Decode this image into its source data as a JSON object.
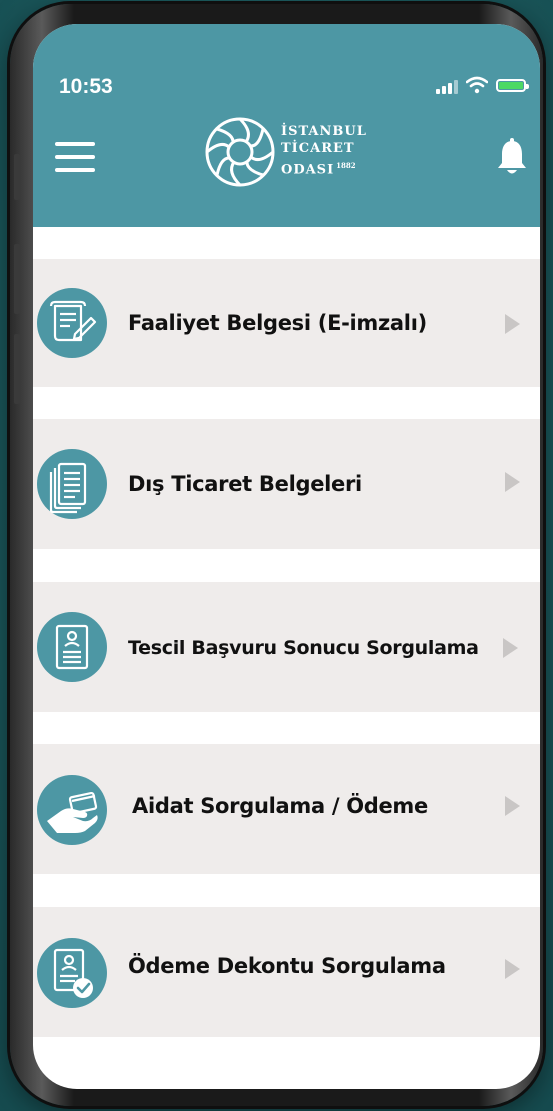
{
  "status_bar": {
    "time": "10:53"
  },
  "header": {
    "logo_line1": "İSTANBUL",
    "logo_line2": "TİCARET",
    "logo_line3": "ODASI",
    "logo_year": "1882",
    "menu_icon": "hamburger-menu-icon",
    "notification_icon": "bell-icon"
  },
  "colors": {
    "header": "#4d97a4",
    "icon_circle": "#4d97a4",
    "row_background": "#efeceb",
    "chevron": "#c9c6c5",
    "battery": "#4cd964"
  },
  "menu": {
    "items": [
      {
        "label": "Faaliyet Belgesi (E-imzalı)",
        "icon": "signed-document-icon"
      },
      {
        "label": "Dış Ticaret Belgeleri",
        "icon": "document-stack-icon"
      },
      {
        "label": "Tescil Başvuru Sonucu Sorgulama",
        "icon": "registration-form-icon"
      },
      {
        "label": "Aidat Sorgulama / Ödeme",
        "icon": "card-payment-icon"
      },
      {
        "label": "Ödeme Dekontu Sorgulama",
        "icon": "verified-receipt-icon"
      }
    ]
  }
}
